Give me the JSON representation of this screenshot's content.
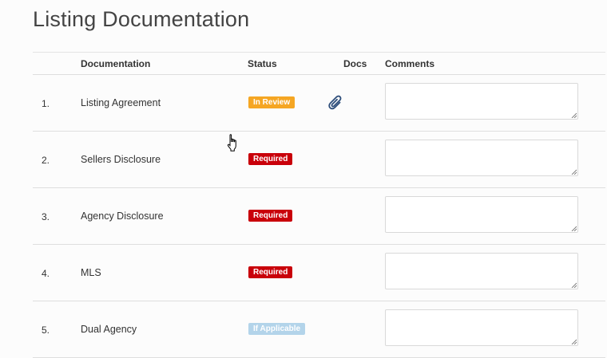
{
  "page": {
    "title": "Listing Documentation"
  },
  "table": {
    "headers": {
      "documentation": "Documentation",
      "status": "Status",
      "docs": "Docs",
      "comments": "Comments"
    },
    "rows": [
      {
        "index": "1.",
        "name": "Listing Agreement",
        "status": "In Review",
        "status_color": "#f5a623",
        "has_docs": true,
        "docs_icon": "paperclip-icon",
        "comment": ""
      },
      {
        "index": "2.",
        "name": "Sellers Disclosure",
        "status": "Required",
        "status_color": "#c9000a",
        "has_docs": false,
        "comment": ""
      },
      {
        "index": "3.",
        "name": "Agency Disclosure",
        "status": "Required",
        "status_color": "#c9000a",
        "has_docs": false,
        "comment": ""
      },
      {
        "index": "4.",
        "name": "MLS",
        "status": "Required",
        "status_color": "#c9000a",
        "has_docs": false,
        "comment": ""
      },
      {
        "index": "5.",
        "name": "Dual Agency",
        "status": "If Applicable",
        "status_color": "#b3d4ea",
        "has_docs": false,
        "comment": ""
      }
    ]
  },
  "cursor": {
    "icon": "hand-pointer-icon"
  }
}
